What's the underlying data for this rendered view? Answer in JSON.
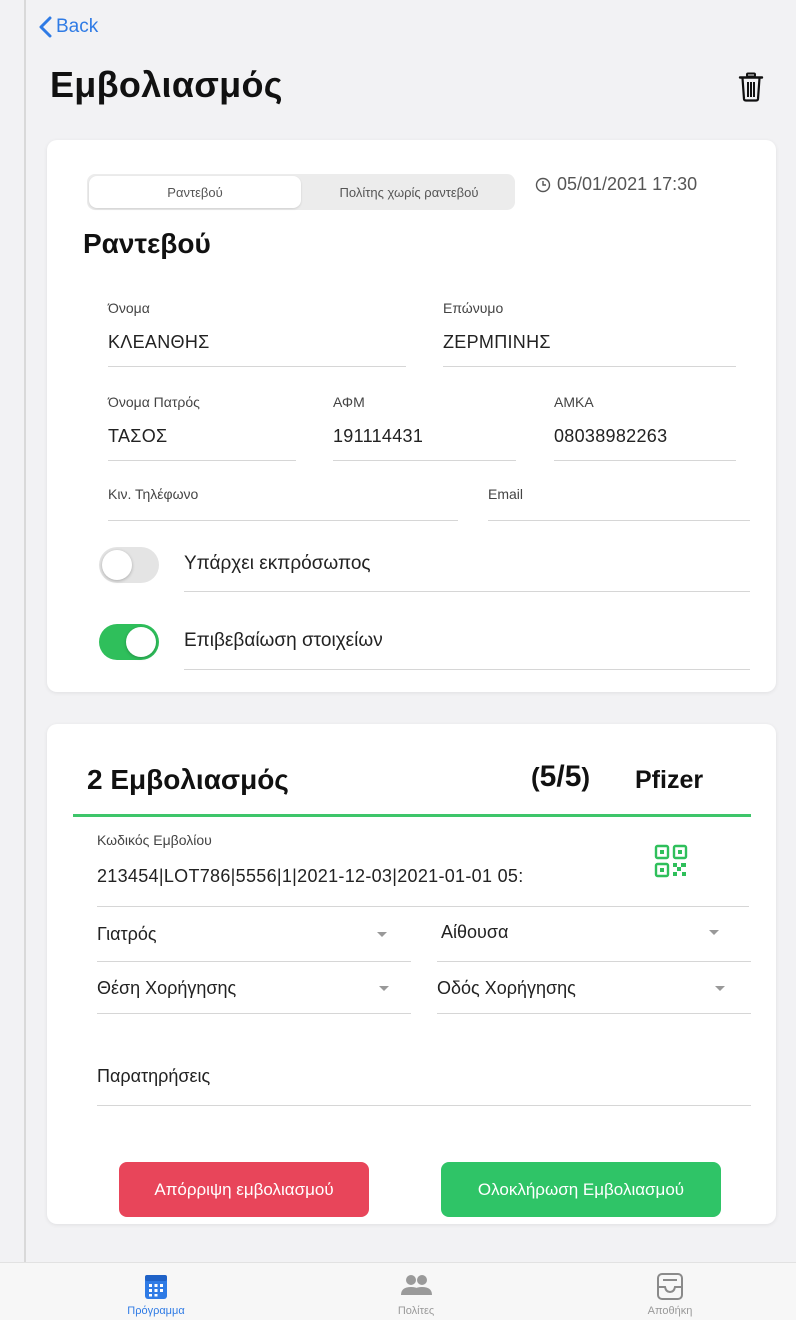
{
  "header": {
    "back_label": "Back",
    "title": "Εμβολιασμός"
  },
  "appointment_card": {
    "segments": [
      "Ραντεβού",
      "Πολίτης χωρίς ραντεβού"
    ],
    "datetime": "05/01/2021 17:30",
    "section_title": "Ραντεβού",
    "fields": {
      "first_name": {
        "label": "Όνομα",
        "value": "ΚΛΕΑΝΘΗΣ"
      },
      "last_name": {
        "label": "Επώνυμο",
        "value": "ΖΕΡΜΠΙΝΗΣ"
      },
      "father_name": {
        "label": "Όνομα Πατρός",
        "value": "ΤΑΣΟΣ"
      },
      "afm": {
        "label": "ΑΦΜ",
        "value": "191114431"
      },
      "amka": {
        "label": "ΑΜΚΑ",
        "value": "08038982263"
      },
      "mobile": {
        "label": "Κιν. Τηλέφωνο",
        "value": ""
      },
      "email": {
        "label": "Email",
        "value": ""
      }
    },
    "toggles": {
      "representative": {
        "label": "Υπάρχει εκπρόσωπος",
        "on": false
      },
      "confirm": {
        "label": "Επιβεβαίωση στοιχείων",
        "on": true
      }
    }
  },
  "vaccination_card": {
    "title": "2 Εμβολιασμός",
    "count": "5/5",
    "count_open": "(",
    "count_close": ")",
    "brand": "Pfizer",
    "vaccine_code_label": "Κωδικός Εμβολίου",
    "vaccine_code_value": "213454|LOT786|5556|1|2021-12-03|2021-01-01 05:",
    "selects": {
      "doctor": "Γιατρός",
      "room": "Αίθουσα",
      "admin_site": "Θέση Χορήγησης",
      "admin_route": "Οδός Χορήγησης"
    },
    "notes_placeholder": "Παρατηρήσεις",
    "reject_label": "Απόρριψη εμβολιασμού",
    "complete_label": "Ολοκλήρωση Εμβολιασμού"
  },
  "tabbar": {
    "items": [
      {
        "label": "Πρόγραμμα",
        "icon": "calendar-icon",
        "active": true
      },
      {
        "label": "Πολίτες",
        "icon": "people-icon",
        "active": false
      },
      {
        "label": "Αποθήκη",
        "icon": "inbox-icon",
        "active": false
      }
    ]
  },
  "colors": {
    "accent_blue": "#2f7be5",
    "green": "#2fc467",
    "red": "#e8455a"
  }
}
